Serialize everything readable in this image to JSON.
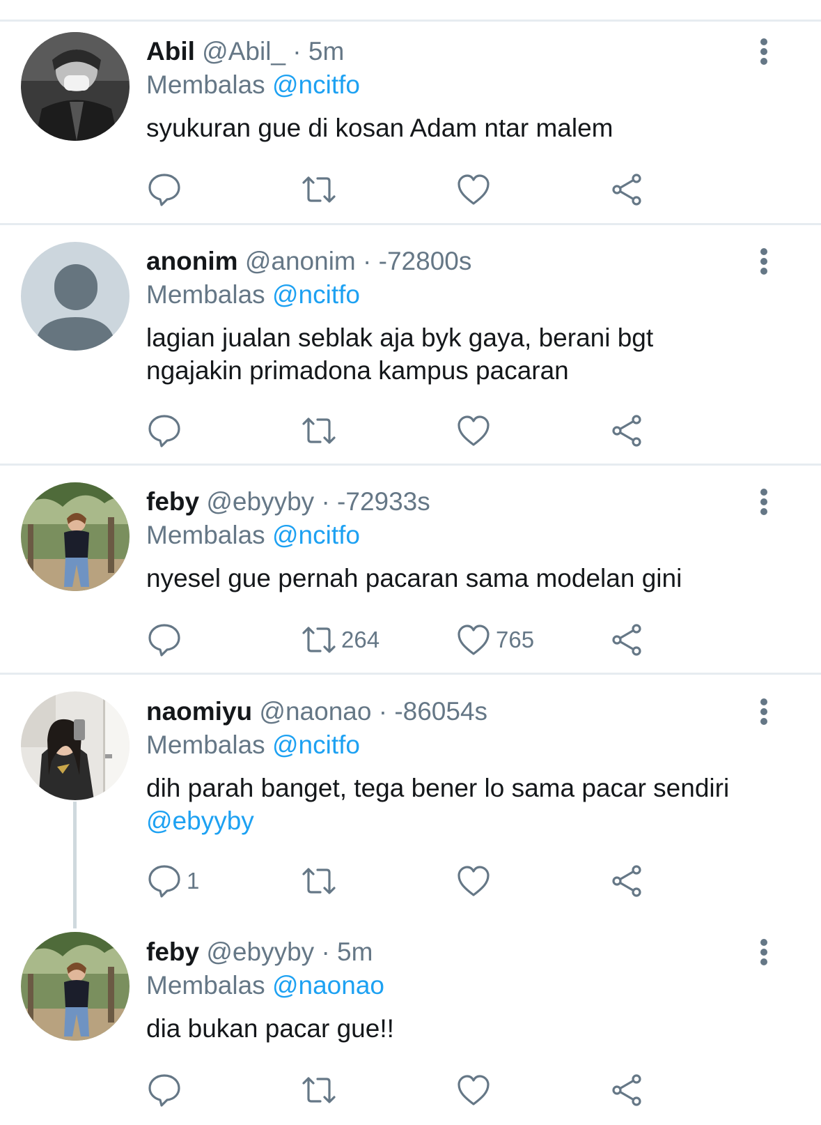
{
  "tweets": [
    {
      "name": "Abil",
      "handle": "@Abil_",
      "time": "· 5m",
      "reply_prefix": "Membalas",
      "reply_to": "@ncitfo",
      "text": "syukuran gue di kosan Adam ntar malem",
      "mention": "",
      "avatar": "bw-jacket-mask",
      "retweets": "",
      "likes": "",
      "replies": ""
    },
    {
      "name": "anonim",
      "handle": "@anonim",
      "time": "· -72800s",
      "reply_prefix": "Membalas",
      "reply_to": "@ncitfo",
      "text": "lagian jualan seblak aja byk gaya, berani bgt ngajakin primadona kampus pacaran",
      "mention": "",
      "avatar": "default-user",
      "retweets": "",
      "likes": "",
      "replies": ""
    },
    {
      "name": "feby",
      "handle": "@ebyyby",
      "time": "· -72933s",
      "reply_prefix": "Membalas",
      "reply_to": "@ncitfo",
      "text": "nyesel gue pernah pacaran sama modelan gini",
      "mention": "",
      "avatar": "girl-outdoor",
      "retweets": "264",
      "likes": "765",
      "replies": ""
    },
    {
      "name": "naomiyu",
      "handle": "@naonao",
      "time": "· -86054s",
      "reply_prefix": "Membalas",
      "reply_to": "@ncitfo",
      "text": "dih parah banget, tega bener lo sama pacar sendiri",
      "mention": "@ebyyby",
      "avatar": "girl-mirror",
      "retweets": "",
      "likes": "",
      "replies": "1"
    },
    {
      "name": "feby",
      "handle": "@ebyyby",
      "time": "· 5m",
      "reply_prefix": "Membalas",
      "reply_to": "@naonao",
      "text": "dia bukan pacar gue!!",
      "mention": "",
      "avatar": "girl-outdoor",
      "retweets": "",
      "likes": "",
      "replies": ""
    }
  ],
  "colors": {
    "link": "#1da1f2",
    "muted": "#657786",
    "text": "#14171a",
    "divider": "#e6ecf0"
  }
}
